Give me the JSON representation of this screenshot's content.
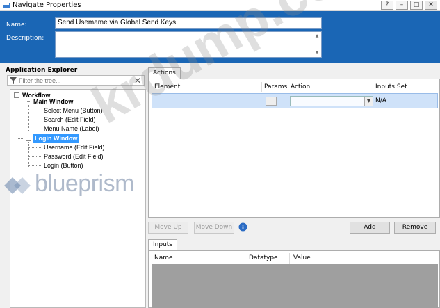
{
  "window": {
    "title": "Navigate Properties",
    "buttons": {
      "help": "?",
      "minimize": "–",
      "maximize": "□",
      "close": "✕"
    }
  },
  "header": {
    "name_label": "Name:",
    "name_value": "Send Usemame via Global Send Keys",
    "description_label": "Description:",
    "description_value": ""
  },
  "explorer": {
    "title": "Application Explorer",
    "filter_placeholder": "Filter the tree...",
    "tree": {
      "workflow": "Workflow",
      "main_window": "Main Window",
      "main_items": [
        "Select Menu (Button)",
        "Search (Edit Field)",
        "Menu Name (Label)"
      ],
      "login_window": "Login Window",
      "login_items": [
        "Username (Edit Field)",
        "Password (Edit Field)",
        "Login (Button)"
      ]
    }
  },
  "watermark": {
    "brand": "blueprism",
    "site": "krdump.com"
  },
  "actions": {
    "tab_label": "Actions",
    "columns": [
      "Element",
      "Params",
      "Action",
      "Inputs Set"
    ],
    "row": {
      "params": "...",
      "inputs_set": "N/A"
    },
    "move_up": "Move Up",
    "move_down": "Move Down",
    "add": "Add",
    "remove": "Remove"
  },
  "inputs": {
    "tab_label": "Inputs",
    "columns": [
      "Name",
      "Datatype",
      "Value"
    ]
  },
  "colors": {
    "header_blue": "#1a66b5",
    "selection_blue": "#3399ff",
    "row_highlight": "#cfe2f9"
  }
}
